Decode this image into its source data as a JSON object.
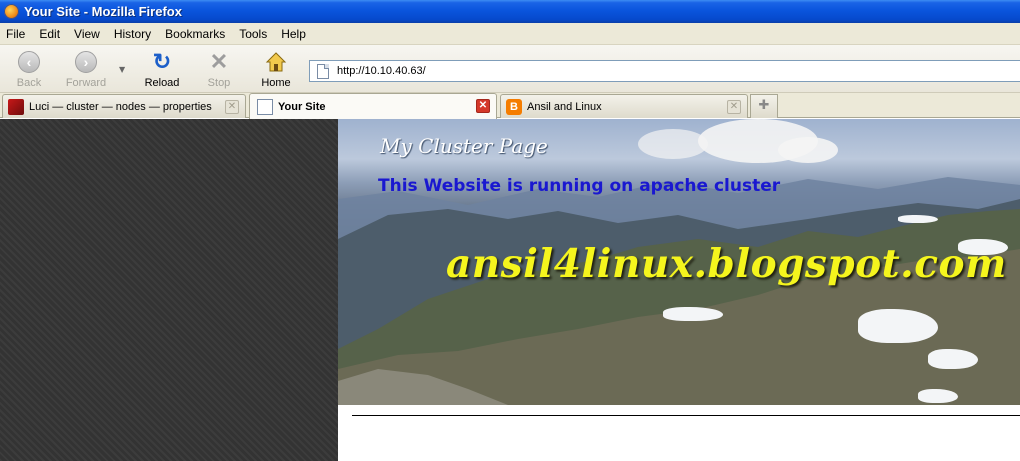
{
  "window": {
    "title": "Your Site - Mozilla Firefox"
  },
  "menu": [
    "File",
    "Edit",
    "View",
    "History",
    "Bookmarks",
    "Tools",
    "Help"
  ],
  "toolbar": {
    "back_label": "Back",
    "forward_label": "Forward",
    "reload_label": "Reload",
    "stop_label": "Stop",
    "home_label": "Home",
    "url": "http://10.10.40.63/"
  },
  "tabs": [
    {
      "label": "Luci — cluster — nodes — properties",
      "icon": "luci-favicon",
      "active": false
    },
    {
      "label": "Your Site",
      "icon": "page-icon",
      "active": true
    },
    {
      "label": "Ansil and Linux",
      "icon": "blogger-favicon",
      "active": false
    }
  ],
  "page": {
    "subtitle": "My Cluster Page",
    "heading": "This Website is running on apache cluster",
    "blog_url": "ansil4linux.blogspot.com"
  },
  "colors": {
    "titlebar": "#0a55dd",
    "heading_text": "#1a18d0",
    "blog_text": "#f5f51d"
  }
}
